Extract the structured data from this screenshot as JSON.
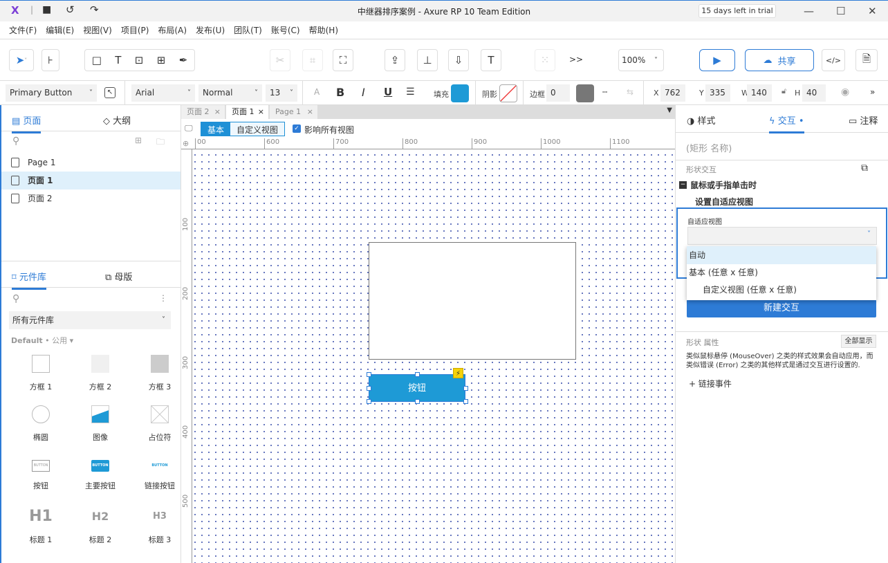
{
  "window": {
    "title": "中继器排序案例 - Axure RP 10 Team Edition",
    "trial": "15 days left in trial"
  },
  "menu": [
    "文件(F)",
    "编辑(E)",
    "视图(V)",
    "项目(P)",
    "布局(A)",
    "发布(U)",
    "团队(T)",
    "账号(C)",
    "帮助(H)"
  ],
  "toolbar": {
    "zoom": "100%",
    "share": "共享",
    "more": ">>"
  },
  "format": {
    "style": "Primary Button",
    "font": "Arial",
    "weight": "Normal",
    "size": "13",
    "fill_label": "填充",
    "fill_color": "#1e9ad6",
    "shadow_label": "阴影",
    "border_label": "边框",
    "border_value": "0",
    "x_label": "X",
    "x": "762",
    "y_label": "Y",
    "y": "335",
    "w_label": "W",
    "w": "140",
    "h_label": "H",
    "h": "40"
  },
  "pages_panel": {
    "tabs": [
      "页面",
      "大纲"
    ],
    "pages": [
      "Page 1",
      "页面 1",
      "页面 2"
    ],
    "selected": 1
  },
  "library_panel": {
    "tabs": [
      "元件库",
      "母版"
    ],
    "library_select": "所有元件库",
    "group_label": "Default",
    "group_sub": "公用",
    "widgets": [
      "方框 1",
      "方框 2",
      "方框 3",
      "椭圆",
      "图像",
      "占位符",
      "按钮",
      "主要按钮",
      "链接按钮",
      "标题 1",
      "标题 2",
      "标题 3"
    ],
    "button_glyph": "BUTTON",
    "heading_glyphs": [
      "H1",
      "H2",
      "H3"
    ]
  },
  "canvas": {
    "tabs": [
      "页面 2",
      "页面 1",
      "Page 1"
    ],
    "active_tab": 1,
    "views": [
      "基本",
      "自定义视图"
    ],
    "affect_all": "影响所有视图",
    "ruler_x": [
      "00",
      "600",
      "700",
      "800",
      "900",
      "1000",
      "1100"
    ],
    "ruler_y": [
      "100",
      "200",
      "300",
      "400",
      "500"
    ],
    "button_label": "按钮"
  },
  "right_panel": {
    "tabs": [
      "样式",
      "交互",
      "注释"
    ],
    "name_placeholder": "(矩形 名称)",
    "shape_interaction": "形状交互",
    "event": "鼠标或手指单击时",
    "action": "设置自适应视图",
    "field_label": "自适应视图",
    "options": [
      "自动",
      "基本 (任意 x 任意)",
      "自定义视图 (任意 x 任意)"
    ],
    "highlighted_option": 0,
    "new_interaction": "新建交互",
    "props_label": "形状 属性",
    "show_all": "全部显示",
    "note": "类似鼠标悬停 (MouseOver) 之类的样式效果会自动应用，而类似错误 (Error) 之类的其他样式是通过交互进行设置的.",
    "link_event": "+ 链接事件"
  }
}
